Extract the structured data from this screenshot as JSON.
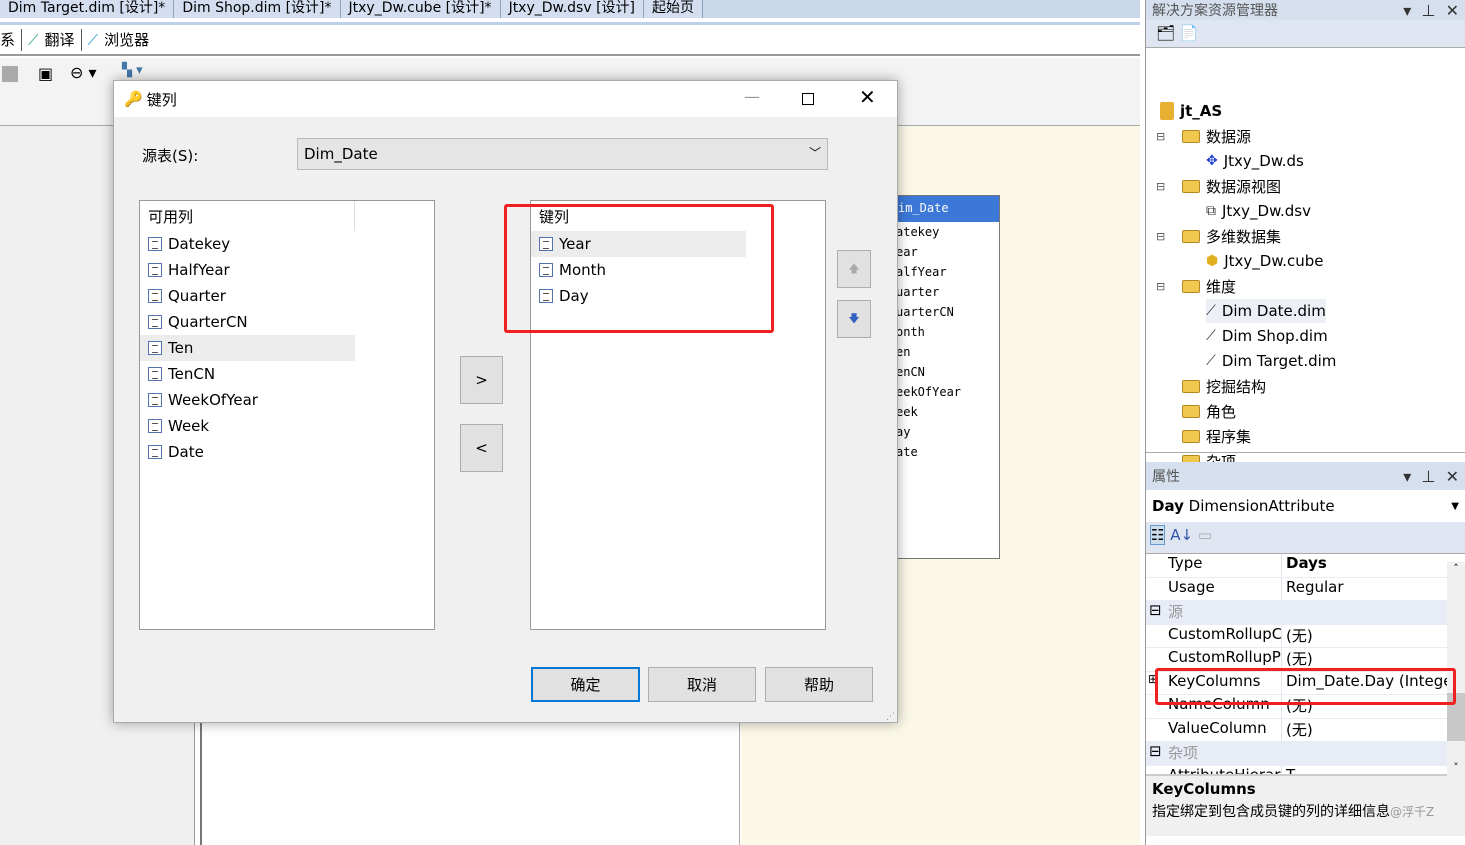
{
  "tabs": [
    "Dim Target.dim [设计]*",
    "Dim Shop.dim [设计]*",
    "Jtxy_Dw.cube [设计]*",
    "Jtxy_Dw.dsv [设计]",
    "起始页"
  ],
  "toolbar": {
    "items": [
      "系",
      "翻译",
      "浏览器"
    ]
  },
  "table_diagram": {
    "title": "im_Date",
    "columns": [
      "atekey",
      "ear",
      "alfYear",
      "uarter",
      "uarterCN",
      "onth",
      "en",
      "enCN",
      "eekOfYear",
      "eek",
      "ay",
      "ate"
    ]
  },
  "dialog": {
    "title": "键列",
    "source_label": "源表(S):",
    "source_value": "Dim_Date",
    "available_header": "可用列",
    "available": [
      "Datekey",
      "HalfYear",
      "Quarter",
      "QuarterCN",
      "Ten",
      "TenCN",
      "WeekOfYear",
      "Week",
      "Date"
    ],
    "key_header": "键列",
    "keys": [
      "Year",
      "Month",
      "Day"
    ],
    "add_label": ">",
    "remove_label": "<",
    "ok": "确定",
    "cancel": "取消",
    "help": "帮助"
  },
  "solution_explorer": {
    "title": "解决方案资源管理器",
    "project": "jt_AS",
    "items": [
      "数据源",
      "Jtxy_Dw.ds",
      "数据源视图",
      "Jtxy_Dw.dsv",
      "多维数据集",
      "Jtxy_Dw.cube",
      "维度",
      "Dim Date.dim",
      "Dim Shop.dim",
      "Dim Target.dim",
      "挖掘结构",
      "角色",
      "程序集",
      "杂项"
    ]
  },
  "properties": {
    "title": "属性",
    "object_name": "Day",
    "object_type": "DimensionAttribute",
    "rows": [
      {
        "k": "Type",
        "v": "Days"
      },
      {
        "k": "Usage",
        "v": "Regular"
      },
      {
        "cat": "源"
      },
      {
        "k": "CustomRollupColumn",
        "v": "(无)"
      },
      {
        "k": "CustomRollupPropertiesColumn",
        "v": "(无)"
      },
      {
        "k": "KeyColumns",
        "v": "Dim_Date.Day (Integer)"
      },
      {
        "k": "NameColumn",
        "v": "(无)"
      },
      {
        "k": "ValueColumn",
        "v": "(无)"
      },
      {
        "cat": "杂项"
      },
      {
        "k": "AttributeHierarchy...",
        "v": "T"
      }
    ],
    "desc_title": "KeyColumns",
    "desc_text": "指定绑定到包含成员键的列的详细信息",
    "watermark": "@浮千Z"
  },
  "colors": {
    "highlight": "#f0201e",
    "table_header": "#3c78d8"
  }
}
